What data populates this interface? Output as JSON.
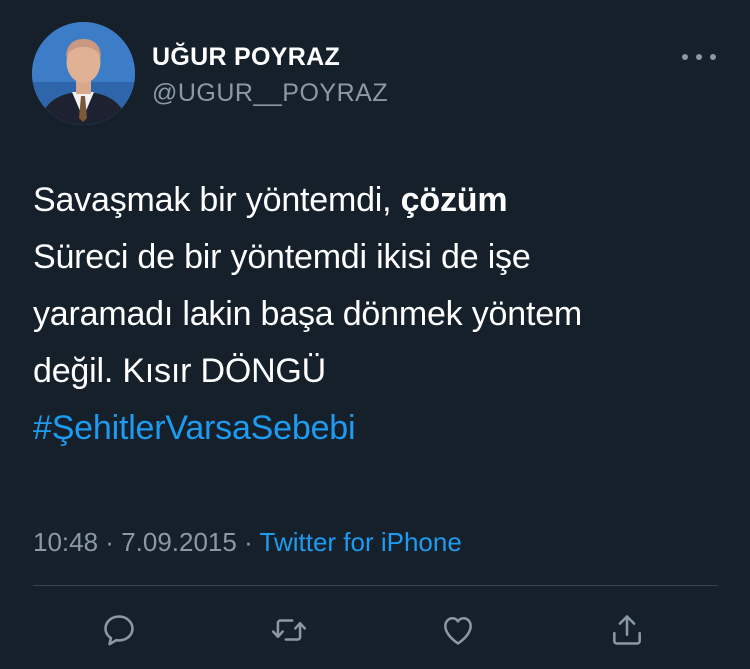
{
  "user": {
    "display_name": "UĞUR POYRAZ",
    "handle": "@UGUR__POYRAZ"
  },
  "tweet": {
    "line1_pre": "Savaşmak bir yöntemdi, ",
    "line1_bold": "çözüm",
    "line2": "Süreci de bir yöntemdi ikisi de işe",
    "line3": "yaramadı lakin başa dönmek yöntem",
    "line4": "değil. Kısır DÖNGÜ",
    "hashtag": "#ŞehitlerVarsaSebebi"
  },
  "meta": {
    "time": "10:48",
    "separator": " · ",
    "date": "7.09.2015",
    "separator2": " · ",
    "source": "Twitter for iPhone"
  },
  "icons": {
    "more": "more-horizontal-icon",
    "reply": "reply-icon",
    "retweet": "retweet-icon",
    "like": "heart-icon",
    "share": "share-icon"
  },
  "colors": {
    "background": "#15202b",
    "text": "#ffffff",
    "secondary": "#8b98a5",
    "accent": "#1d9bf0",
    "divider": "#38444d"
  }
}
